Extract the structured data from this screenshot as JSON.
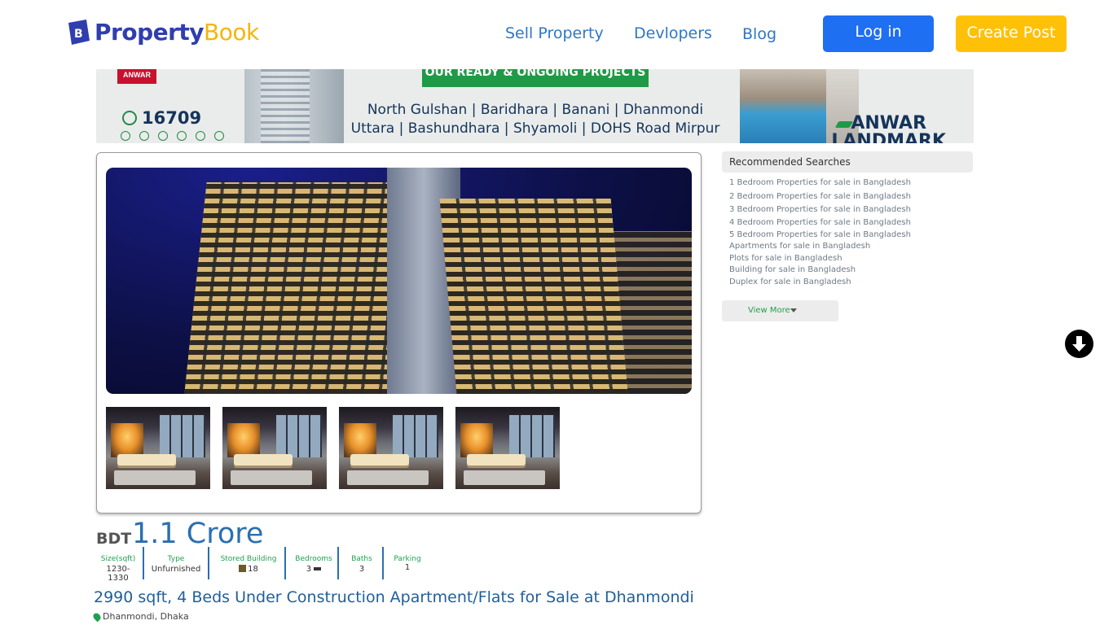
{
  "header": {
    "logo_part1": "Property",
    "logo_part2": "Book",
    "logo_mark": "B",
    "nav": [
      "Sell Property",
      "Devlopers",
      "Blog"
    ],
    "login_label": "Log in",
    "create_post_label": "Create Post"
  },
  "banner": {
    "brand_badge": "ANWAR",
    "phone": "16709",
    "heading": "OUR READY & ONGOING PROJECTS",
    "line1": "North Gulshan | Baridhara | Banani | Dhanmondi",
    "line2": "Uttara | Bashundhara | Shyamoli | DOHS Road Mirpur",
    "brand_line1": "ANWAR",
    "brand_line2": "LANDMARK"
  },
  "listing": {
    "currency": "BDT",
    "price": "1.1 Crore",
    "specs": [
      {
        "label": "Size(sqft)",
        "value": "1230-1330"
      },
      {
        "label": "Type",
        "value": "Unfurnished"
      },
      {
        "label": "Stored Building",
        "value": "18"
      },
      {
        "label": "Bedrooms",
        "value": "3"
      },
      {
        "label": "Baths",
        "value": "3"
      },
      {
        "label": "Parking",
        "value": "1"
      }
    ],
    "title": "2990 sqft, 4 Beds Under Construction Apartment/Flats for Sale at Dhanmondi",
    "location": "Dhanmondi, Dhaka"
  },
  "recommended": {
    "heading": "Recommended Searches",
    "items": [
      "1 Bedroom Properties for sale in Bangladesh",
      "2 Bedroom Properties for sale in Bangladesh",
      "3 Bedroom Properties for sale in Bangladesh",
      "4 Bedroom Properties for sale in Bangladesh",
      "5 Bedroom Properties for sale in Bangladesh",
      "Apartments for sale in Bangladesh",
      "Plots for sale in Bangladesh",
      "Building for sale in Bangladesh",
      "Duplex for sale in Bangladesh"
    ],
    "view_more": "View More"
  },
  "icons": {
    "bed": "bed-icon",
    "building": "building-icon",
    "location": "location-pin-icon",
    "download": "arrow-down-circle-icon"
  },
  "colors": {
    "brand_blue": "#2f3eaf",
    "brand_yellow": "#f5b50a",
    "login_bg": "#1e6ff1",
    "create_bg": "#ffc107",
    "accent_green": "#1fa04f",
    "price_blue": "#2a6fb0"
  }
}
